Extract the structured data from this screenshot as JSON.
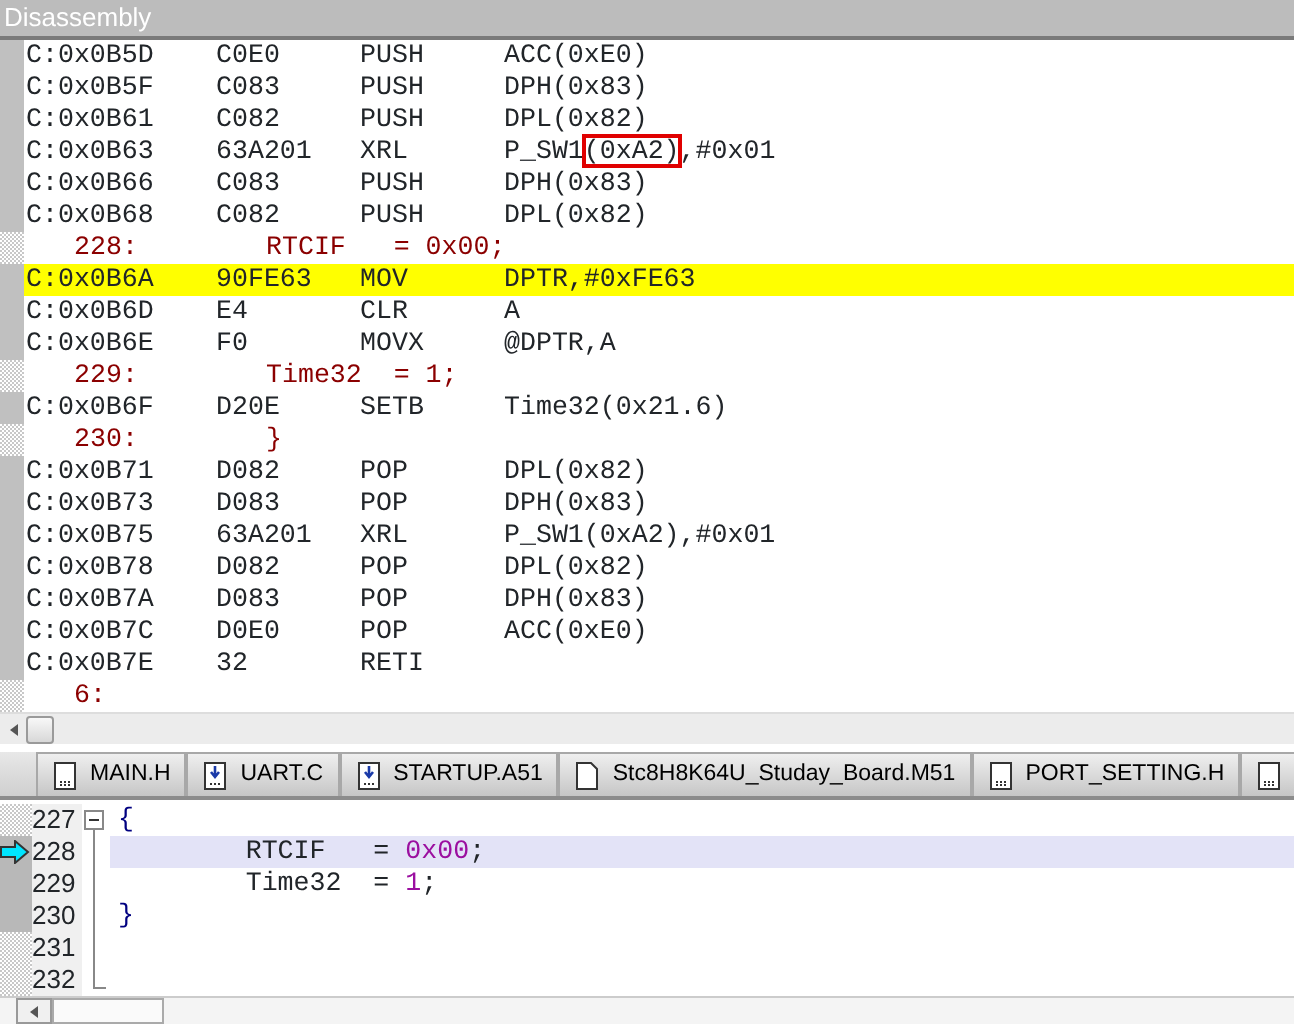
{
  "window": {
    "title": "Disassembly"
  },
  "disassembly": [
    {
      "kind": "asm",
      "address": "C:0x0B5D",
      "opcode": "C0E0",
      "mnemonic": "PUSH",
      "operand": [
        {
          "text": "ACC(0xE0)"
        }
      ],
      "current": false
    },
    {
      "kind": "asm",
      "address": "C:0x0B5F",
      "opcode": "C083",
      "mnemonic": "PUSH",
      "operand": [
        {
          "text": "DPH(0x83)"
        }
      ],
      "current": false
    },
    {
      "kind": "asm",
      "address": "C:0x0B61",
      "opcode": "C082",
      "mnemonic": "PUSH",
      "operand": [
        {
          "text": "DPL(0x82)"
        }
      ],
      "current": false
    },
    {
      "kind": "asm",
      "address": "C:0x0B63",
      "opcode": "63A201",
      "mnemonic": "XRL",
      "operand": [
        {
          "text": "P_SW1"
        },
        {
          "text": "(0xA2)",
          "boxed": true
        },
        {
          "text": ",#0x01"
        }
      ],
      "current": false
    },
    {
      "kind": "asm",
      "address": "C:0x0B66",
      "opcode": "C083",
      "mnemonic": "PUSH",
      "operand": [
        {
          "text": "DPH(0x83)"
        }
      ],
      "current": false
    },
    {
      "kind": "asm",
      "address": "C:0x0B68",
      "opcode": "C082",
      "mnemonic": "PUSH",
      "operand": [
        {
          "text": "DPL(0x82)"
        }
      ],
      "current": false
    },
    {
      "kind": "source",
      "line": "228:",
      "code": "RTCIF   = 0x00;"
    },
    {
      "kind": "asm",
      "address": "C:0x0B6A",
      "opcode": "90FE63",
      "mnemonic": "MOV",
      "operand": [
        {
          "text": "DPTR,#0xFE63"
        }
      ],
      "current": true
    },
    {
      "kind": "asm",
      "address": "C:0x0B6D",
      "opcode": "E4",
      "mnemonic": "CLR",
      "operand": [
        {
          "text": "A"
        }
      ],
      "current": false
    },
    {
      "kind": "asm",
      "address": "C:0x0B6E",
      "opcode": "F0",
      "mnemonic": "MOVX",
      "operand": [
        {
          "text": "@DPTR,A"
        }
      ],
      "current": false
    },
    {
      "kind": "source",
      "line": "229:",
      "code": "Time32  = 1;"
    },
    {
      "kind": "asm",
      "address": "C:0x0B6F",
      "opcode": "D20E",
      "mnemonic": "SETB",
      "operand": [
        {
          "text": "Time32(0x21.6)"
        }
      ],
      "current": false
    },
    {
      "kind": "source",
      "line": "230:",
      "code": "}"
    },
    {
      "kind": "asm",
      "address": "C:0x0B71",
      "opcode": "D082",
      "mnemonic": "POP",
      "operand": [
        {
          "text": "DPL(0x82)"
        }
      ],
      "current": false
    },
    {
      "kind": "asm",
      "address": "C:0x0B73",
      "opcode": "D083",
      "mnemonic": "POP",
      "operand": [
        {
          "text": "DPH(0x83)"
        }
      ],
      "current": false
    },
    {
      "kind": "asm",
      "address": "C:0x0B75",
      "opcode": "63A201",
      "mnemonic": "XRL",
      "operand": [
        {
          "text": "P_SW1(0xA2),#0x01"
        }
      ],
      "current": false
    },
    {
      "kind": "asm",
      "address": "C:0x0B78",
      "opcode": "D082",
      "mnemonic": "POP",
      "operand": [
        {
          "text": "DPL(0x82)"
        }
      ],
      "current": false
    },
    {
      "kind": "asm",
      "address": "C:0x0B7A",
      "opcode": "D083",
      "mnemonic": "POP",
      "operand": [
        {
          "text": "DPH(0x83)"
        }
      ],
      "current": false
    },
    {
      "kind": "asm",
      "address": "C:0x0B7C",
      "opcode": "D0E0",
      "mnemonic": "POP",
      "operand": [
        {
          "text": "ACC(0xE0)"
        }
      ],
      "current": false
    },
    {
      "kind": "asm",
      "address": "C:0x0B7E",
      "opcode": "32",
      "mnemonic": "RETI",
      "current": false
    },
    {
      "kind": "source",
      "line": "6:"
    }
  ],
  "tabs": [
    {
      "label": "MAIN.H",
      "kind": "header",
      "selected": false
    },
    {
      "label": "UART.C",
      "kind": "source",
      "selected": false
    },
    {
      "label": "STARTUP.A51",
      "kind": "source",
      "selected": false
    },
    {
      "label": "Stc8H8K64U_Studay_Board.M51",
      "kind": "listing",
      "selected": false
    },
    {
      "label": "PORT_SETTING.H",
      "kind": "header",
      "selected": false
    }
  ],
  "editor": [
    {
      "number": "227",
      "kind": "start",
      "executable": false,
      "current": false,
      "tokens": [
        {
          "text": "{",
          "kind": "brace"
        }
      ]
    },
    {
      "number": "228",
      "kind": "middle",
      "executable": true,
      "current": true,
      "tokens": [
        {
          "text": "        RTCIF   = ",
          "kind": "plain"
        },
        {
          "text": "0x00",
          "kind": "number"
        },
        {
          "text": ";",
          "kind": "plain"
        }
      ]
    },
    {
      "number": "229",
      "kind": "middle",
      "executable": true,
      "current": false,
      "tokens": [
        {
          "text": "        Time32  = ",
          "kind": "plain"
        },
        {
          "text": "1",
          "kind": "number"
        },
        {
          "text": ";",
          "kind": "plain"
        }
      ]
    },
    {
      "number": "230",
      "kind": "middle",
      "executable": true,
      "current": false,
      "tokens": [
        {
          "text": "}",
          "kind": "brace"
        }
      ]
    },
    {
      "number": "231",
      "kind": "middle",
      "executable": false,
      "current": false
    },
    {
      "number": "232",
      "kind": "end",
      "executable": false,
      "current": false
    }
  ]
}
